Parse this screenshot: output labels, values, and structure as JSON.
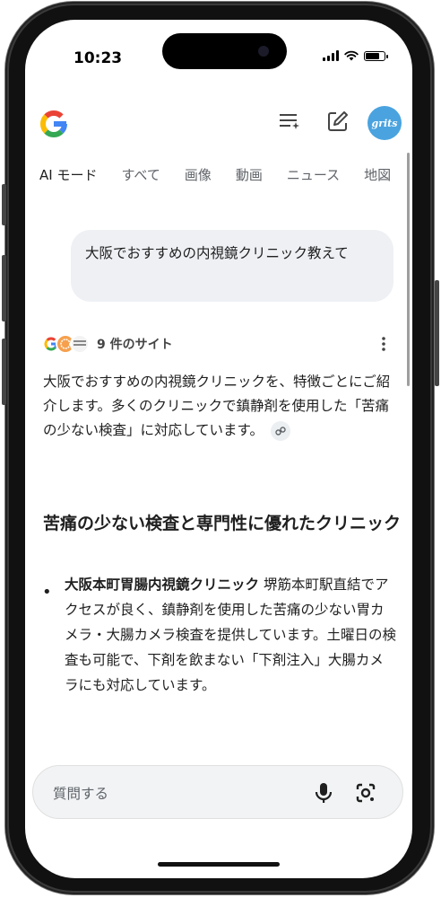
{
  "status": {
    "time": "10:23",
    "battery_level": 0.85
  },
  "header": {
    "avatar_text": "grits"
  },
  "tabs": [
    {
      "label": "AI モード",
      "active": true
    },
    {
      "label": "すべて"
    },
    {
      "label": "画像"
    },
    {
      "label": "動画"
    },
    {
      "label": "ニュース"
    },
    {
      "label": "地図"
    }
  ],
  "query": {
    "text": "大阪でおすすめの内視鏡クリニック教えて"
  },
  "sources": {
    "label": "9 件のサイト"
  },
  "answer": {
    "intro": "大阪でおすすめの内視鏡クリニックを、特徴ごとにご紹介します。多くのクリニックで鎮静剤を使用した「苦痛の少ない検査」に対応しています。",
    "section_title": "苦痛の少ない検査と専門性に優れたクリニック",
    "bullets": [
      {
        "name": "大阪本町胃腸内視鏡クリニック",
        "text": " 堺筋本町駅直結でアクセスが良く、鎮静剤を使用した苦痛の少ない胃カメラ・大腸カメラ検査を提供しています。土曜日の検査も可能で、下剤を飲まない「下剤注入」大腸カメラにも対応しています。"
      }
    ]
  },
  "input": {
    "placeholder": "質問する"
  },
  "colors": {
    "google_blue": "#4285F4",
    "google_red": "#EA4335",
    "google_yellow": "#FBBC05",
    "google_green": "#34A853"
  }
}
